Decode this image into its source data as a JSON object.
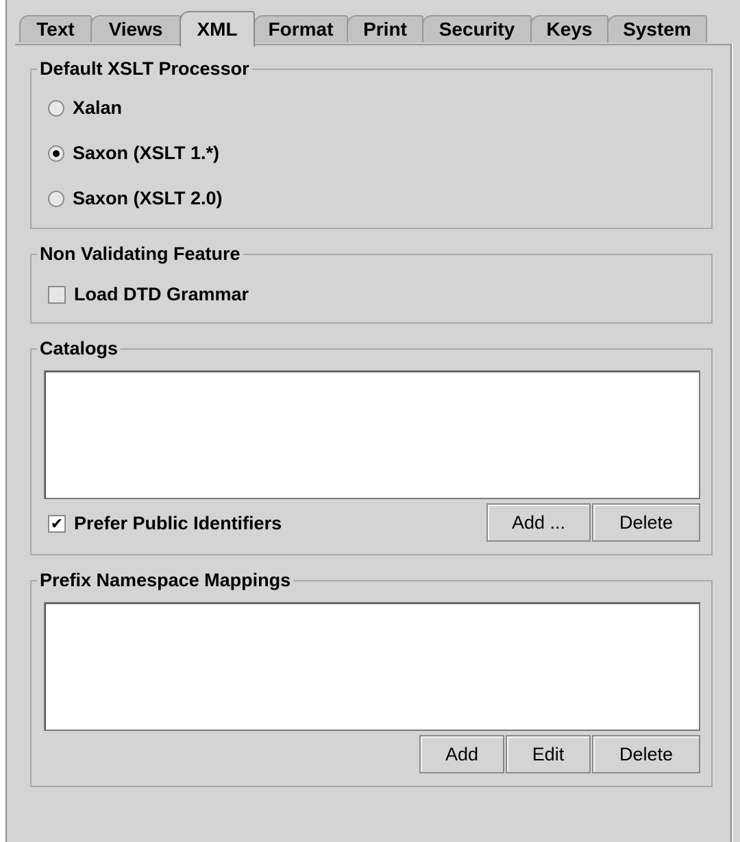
{
  "tabs": [
    {
      "label": "Text",
      "selected": false
    },
    {
      "label": "Views",
      "selected": false
    },
    {
      "label": "XML",
      "selected": true
    },
    {
      "label": "Format",
      "selected": false
    },
    {
      "label": "Print",
      "selected": false
    },
    {
      "label": "Security",
      "selected": false
    },
    {
      "label": "Keys",
      "selected": false
    },
    {
      "label": "System",
      "selected": false
    }
  ],
  "xslt": {
    "title": "Default XSLT Processor",
    "options": [
      {
        "label": "Xalan",
        "selected": false
      },
      {
        "label": "Saxon (XSLT 1.*)",
        "selected": true
      },
      {
        "label": "Saxon (XSLT 2.0)",
        "selected": false
      }
    ]
  },
  "nonvalidating": {
    "title": "Non Validating Feature",
    "load_dtd_label": "Load DTD Grammar",
    "load_dtd_checked": false
  },
  "catalogs": {
    "title": "Catalogs",
    "items": [],
    "prefer_public_label": "Prefer Public Identifiers",
    "prefer_public_checked": true,
    "check_glyph": "✔",
    "add_label": "Add ...",
    "delete_label": "Delete"
  },
  "mappings": {
    "title": "Prefix Namespace Mappings",
    "items": [],
    "add_label": "Add",
    "edit_label": "Edit",
    "delete_label": "Delete"
  }
}
